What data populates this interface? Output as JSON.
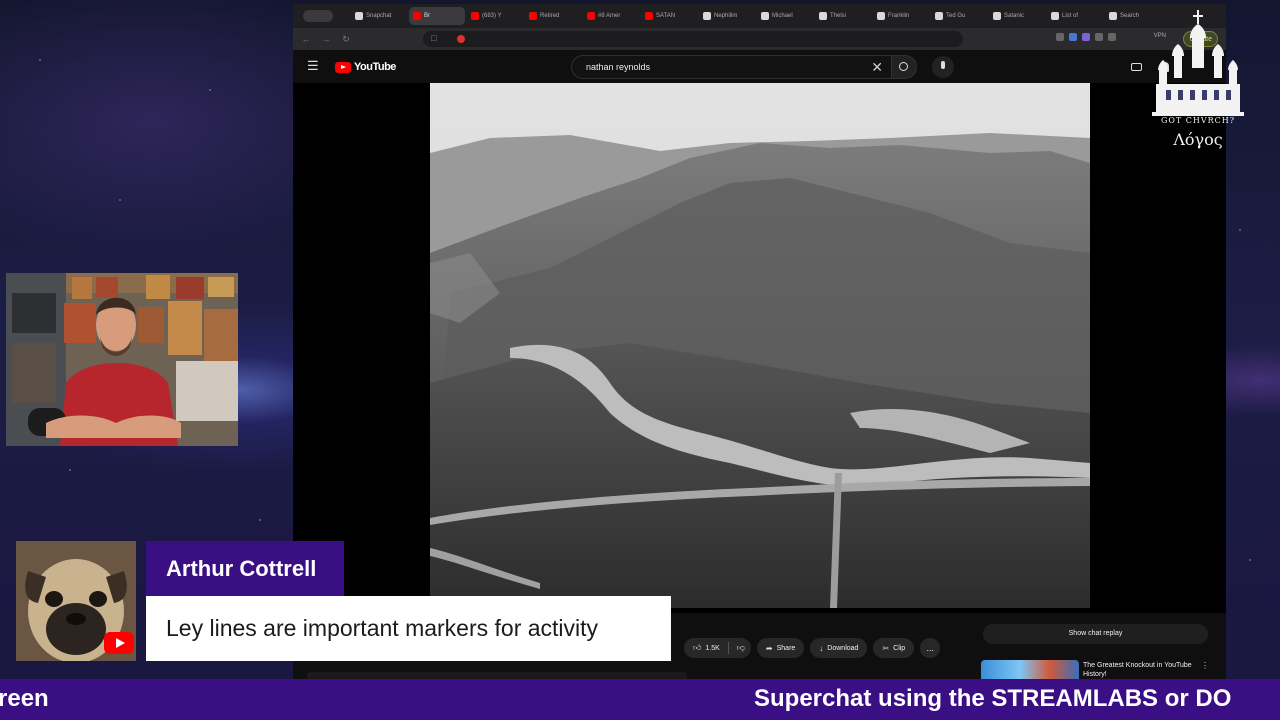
{
  "browser": {
    "tabs": [
      {
        "label": "Snapchat",
        "icon": "doc-favicon-icon",
        "active": false
      },
      {
        "label": "Br",
        "icon": "youtube-favicon-icon",
        "active": true
      },
      {
        "label": "(683) Y",
        "icon": "youtube-favicon-icon",
        "active": false
      },
      {
        "label": "Retired",
        "icon": "youtube-favicon-icon",
        "active": false
      },
      {
        "label": "#8 Amer",
        "icon": "youtube-favicon-icon",
        "active": false
      },
      {
        "label": "SATAN",
        "icon": "youtube-favicon-icon",
        "active": false
      },
      {
        "label": "Nephilim",
        "icon": "doc-favicon-icon",
        "active": false
      },
      {
        "label": "Michael",
        "icon": "doc-favicon-icon",
        "active": false
      },
      {
        "label": "Thelsi",
        "icon": "doc-favicon-icon",
        "active": false
      },
      {
        "label": "Franklin",
        "icon": "doc-favicon-icon",
        "active": false
      },
      {
        "label": "Ted Gu",
        "icon": "doc-favicon-icon",
        "active": false
      },
      {
        "label": "Satanic",
        "icon": "doc-favicon-icon",
        "active": false
      },
      {
        "label": "List of",
        "icon": "doc-favicon-icon",
        "active": false
      },
      {
        "label": "Search",
        "icon": "doc-favicon-icon",
        "active": false
      }
    ],
    "vpn_label": "VPN",
    "update_label": "Update"
  },
  "youtube": {
    "logo_text": "YouTube",
    "search_query": "nathan reynolds",
    "actions": {
      "like_count": "1.5K",
      "share": "Share",
      "download": "Download",
      "clip": "Clip",
      "more": "..."
    },
    "show_chat_replay": "Show chat replay",
    "recommended_title": "The Greatest Knockout in YouTube History!"
  },
  "overlay": {
    "logo_caption": "GOT CHVRCH?",
    "logo_greek": "Λόγος",
    "chat": {
      "author": "Arthur Cottrell",
      "message": "Ley lines are important markers for activity"
    },
    "ticker": {
      "left_text": "reen",
      "right_text": "Superchat using the STREAMLABS or DO"
    }
  },
  "colors": {
    "ticker_bg": "#3b0f84",
    "chat_name_bg": "#3b0f84",
    "youtube_red": "#ff0000",
    "browser_bg": "#0f0f0f"
  }
}
